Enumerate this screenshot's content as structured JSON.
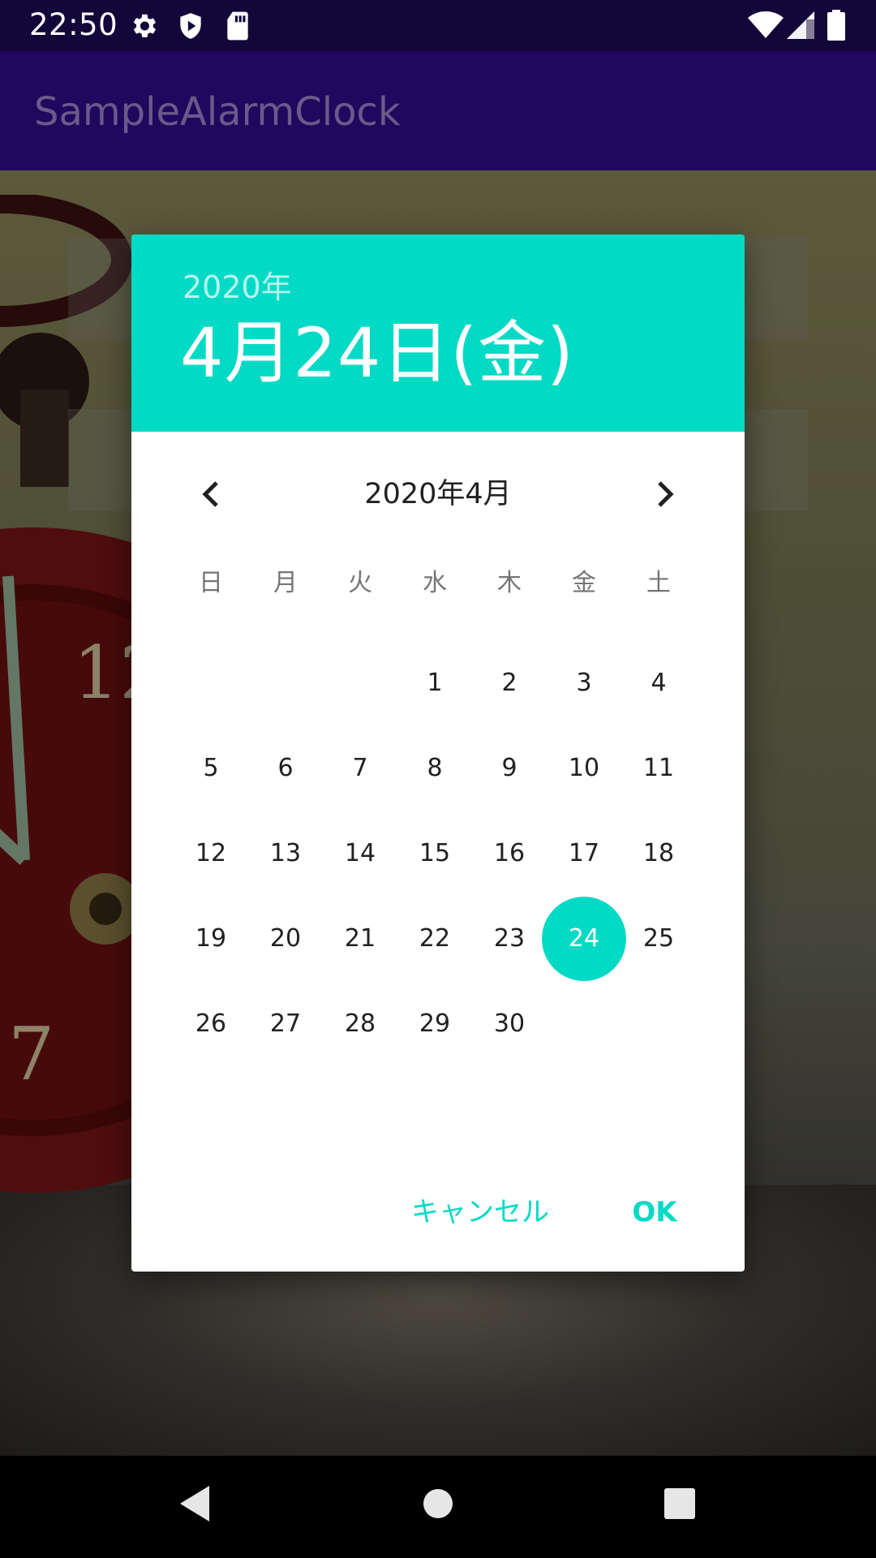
{
  "status_bar": {
    "time": "22:50",
    "left_icons": [
      "gear-icon",
      "shield-icon",
      "sd-card-icon"
    ],
    "right_icons": [
      "wifi-icon",
      "cell-signal-icon",
      "battery-icon"
    ]
  },
  "app_bar": {
    "title": "SampleAlarmClock"
  },
  "dialog": {
    "header": {
      "year": "2020年",
      "date": "4月24日(金)"
    },
    "month_label": "2020年4月",
    "weekdays": [
      "日",
      "月",
      "火",
      "水",
      "木",
      "金",
      "土"
    ],
    "weeks": [
      [
        "",
        "",
        "",
        "1",
        "2",
        "3",
        "4"
      ],
      [
        "5",
        "6",
        "7",
        "8",
        "9",
        "10",
        "11"
      ],
      [
        "12",
        "13",
        "14",
        "15",
        "16",
        "17",
        "18"
      ],
      [
        "19",
        "20",
        "21",
        "22",
        "23",
        "24",
        "25"
      ],
      [
        "26",
        "27",
        "28",
        "29",
        "30",
        "",
        ""
      ]
    ],
    "selected_day": "24",
    "cancel_label": "キャンセル",
    "ok_label": "OK"
  },
  "colors": {
    "accent": "#03dac5",
    "app_bar": "#22075e",
    "status_bar": "#13073a"
  }
}
